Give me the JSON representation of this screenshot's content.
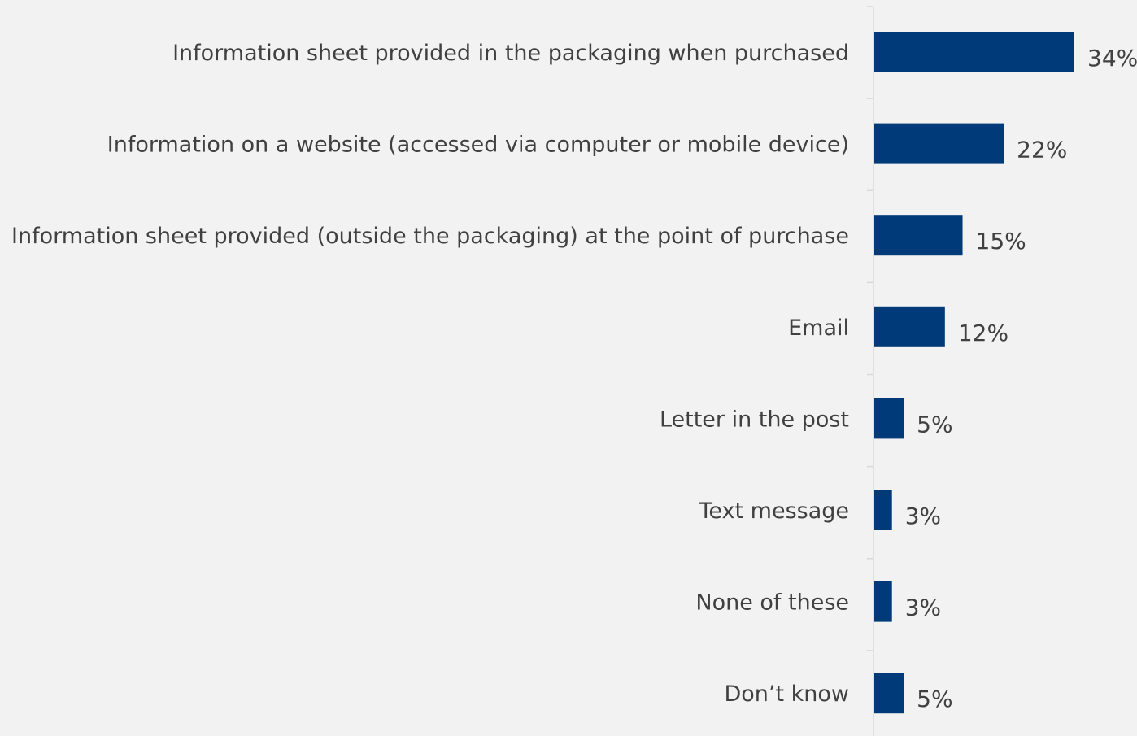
{
  "chart_data": {
    "type": "bar",
    "orientation": "horizontal",
    "title": "",
    "xlabel": "",
    "ylabel": "",
    "categories": [
      "Information sheet provided in the packaging when purchased",
      "Information on a website (accessed via computer or mobile device)",
      "Information sheet provided (outside the packaging) at the point of purchase",
      "Email",
      "Letter in the post",
      "Text message",
      "None of these",
      "Don’t know"
    ],
    "values": [
      34,
      22,
      15,
      12,
      5,
      3,
      3,
      5
    ],
    "value_labels": [
      "34%",
      "22%",
      "15%",
      "12%",
      "5%",
      "3%",
      "3%",
      "5%"
    ],
    "xlim": [
      0,
      34
    ],
    "grid": false,
    "legend": "none",
    "bar_color": "#003a78",
    "axis_color": "#d9d9d9",
    "background": "#f2f2f2"
  }
}
